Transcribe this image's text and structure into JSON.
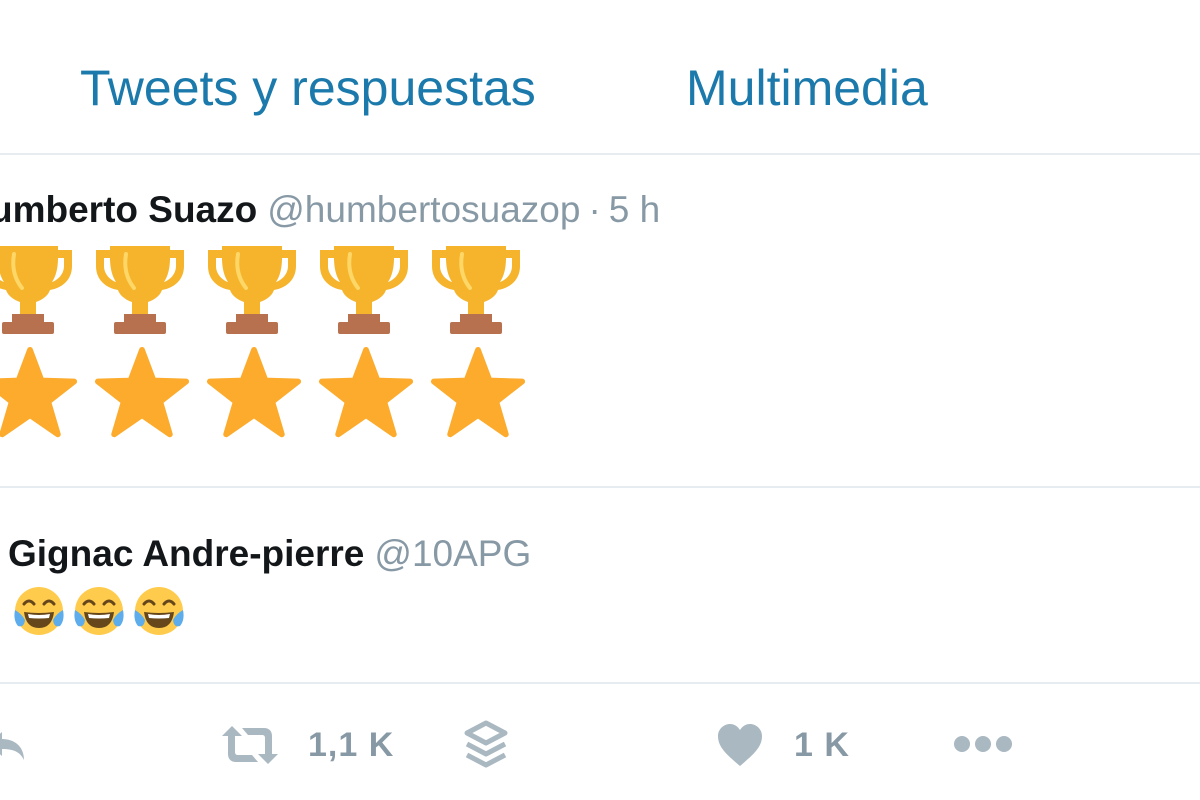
{
  "tabs": [
    {
      "label": "Tweets y respuestas"
    },
    {
      "label": "Multimedia"
    }
  ],
  "tweets": [
    {
      "author_name": "umberto Suazo",
      "handle": "@humbertosuazop",
      "separator": "·",
      "time": "5 h",
      "emoji_rows": [
        {
          "icon": "trophy-icon",
          "count": 5
        },
        {
          "icon": "star-icon",
          "count": 5
        }
      ]
    },
    {
      "author_name": "Gignac Andre-pierre",
      "handle": "@10APG",
      "emoji_rows": [
        {
          "icon": "tears-of-joy-icon",
          "count": 3
        }
      ]
    }
  ],
  "actions": {
    "reply": {
      "icon": "reply-icon"
    },
    "retweet": {
      "icon": "retweet-icon",
      "count": "1,1 K"
    },
    "stack": {
      "icon": "stack-icon"
    },
    "like": {
      "icon": "heart-icon",
      "count": "1 K"
    },
    "more": {
      "icon": "more-icon"
    }
  },
  "colors": {
    "link_blue": "#1b7aab",
    "text_dark": "#14171a",
    "text_muted": "#8899a6",
    "divider": "#e6ecf0",
    "trophy_gold": "#f5b42b",
    "trophy_base": "#b8714e",
    "star_gold": "#fcab2c",
    "icon_gray": "#aab8c2"
  }
}
